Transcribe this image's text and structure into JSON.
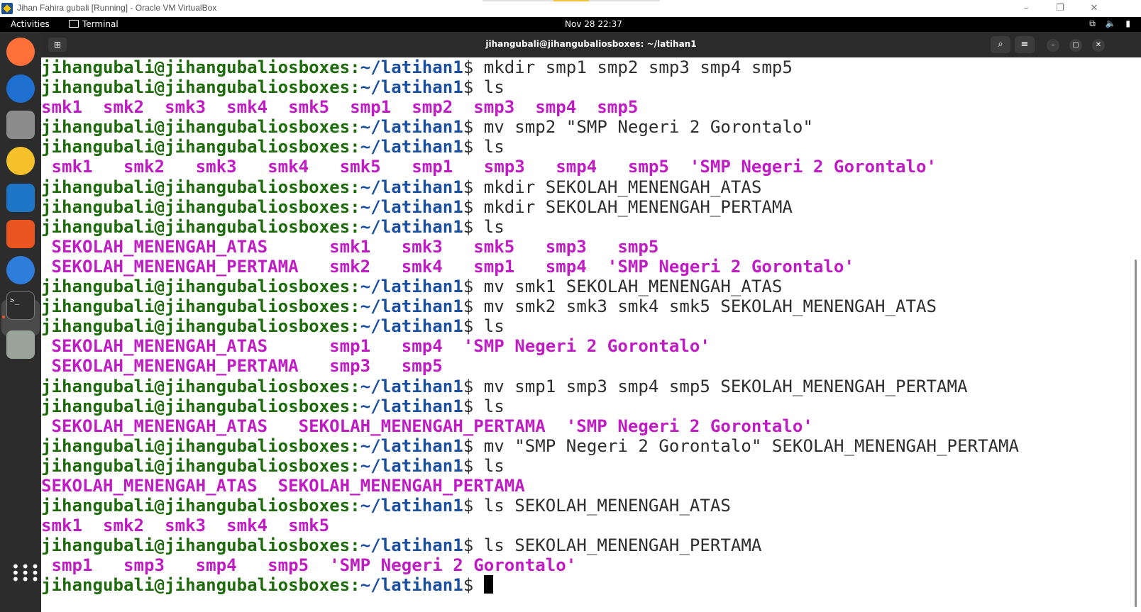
{
  "host_window": {
    "title": "Jihan Fahira gubali [Running] - Oracle VM VirtualBox",
    "controls": [
      "–",
      "❐",
      "✕"
    ]
  },
  "topbar": {
    "activities": "Activities",
    "app_name": "Terminal",
    "datetime": "Nov 28  22:37",
    "tray_icons": [
      "network-icon",
      "volume-icon",
      "battery-icon"
    ],
    "tray_glyphs": "⧉ 🔈 ▮"
  },
  "dock": {
    "apps": [
      {
        "name": "firefox-icon",
        "color": "#ff7139"
      },
      {
        "name": "thunderbird-icon",
        "color": "#1f6fd1"
      },
      {
        "name": "files-icon",
        "color": "#8c8c8c"
      },
      {
        "name": "rhythmbox-icon",
        "color": "#f6c12b"
      },
      {
        "name": "libreoffice-writer-icon",
        "color": "#1e75c8"
      },
      {
        "name": "app-center-icon",
        "color": "#e95420"
      },
      {
        "name": "help-icon",
        "color": "#2f7ddb"
      },
      {
        "name": "terminal-icon",
        "color": "#2d2d2d"
      },
      {
        "name": "trash-icon",
        "color": "#9aa39a"
      }
    ],
    "show_apps_glyph": "⋮⋮⋮"
  },
  "terminal": {
    "title": "jihangubali@jihangubaliosboxes: ~/latihan1",
    "buttons": {
      "new_tab": "⊞",
      "search": "⌕",
      "menu": "≡",
      "minimize": "–",
      "maximize": "▢",
      "close": "✕"
    },
    "prompt": {
      "user": "jihangubali@jihangubaliosboxes",
      "colon": ":",
      "path": "~/latihan1",
      "dollar": "$ "
    },
    "lines": [
      {
        "type": "cmd",
        "text": "mkdir smp1 smp2 smp3 smp4 smp5"
      },
      {
        "type": "cmd",
        "text": "ls"
      },
      {
        "type": "out",
        "text": "smk1  smk2  smk3  smk4  smk5  smp1  smp2  smp3  smp4  smp5"
      },
      {
        "type": "cmd",
        "text": "mv smp2 \"SMP Negeri 2 Gorontalo\""
      },
      {
        "type": "cmd",
        "text": "ls"
      },
      {
        "type": "out",
        "text": " smk1   smk2   smk3   smk4   smk5   smp1   smp3   smp4   smp5  'SMP Negeri 2 Gorontalo'"
      },
      {
        "type": "cmd",
        "text": "mkdir SEKOLAH_MENENGAH_ATAS"
      },
      {
        "type": "cmd",
        "text": "mkdir SEKOLAH_MENENGAH_PERTAMA"
      },
      {
        "type": "cmd",
        "text": "ls"
      },
      {
        "type": "out",
        "text": " SEKOLAH_MENENGAH_ATAS      smk1   smk3   smk5   smp3   smp5"
      },
      {
        "type": "out",
        "text": " SEKOLAH_MENENGAH_PERTAMA   smk2   smk4   smp1   smp4  'SMP Negeri 2 Gorontalo'"
      },
      {
        "type": "cmd",
        "text": "mv smk1 SEKOLAH_MENENGAH_ATAS"
      },
      {
        "type": "cmd",
        "text": "mv smk2 smk3 smk4 smk5 SEKOLAH_MENENGAH_ATAS"
      },
      {
        "type": "cmd",
        "text": "ls"
      },
      {
        "type": "out",
        "text": " SEKOLAH_MENENGAH_ATAS      smp1   smp4  'SMP Negeri 2 Gorontalo'"
      },
      {
        "type": "out",
        "text": " SEKOLAH_MENENGAH_PERTAMA   smp3   smp5"
      },
      {
        "type": "cmd",
        "text": "mv smp1 smp3 smp4 smp5 SEKOLAH_MENENGAH_PERTAMA"
      },
      {
        "type": "cmd",
        "text": "ls"
      },
      {
        "type": "out",
        "text": " SEKOLAH_MENENGAH_ATAS   SEKOLAH_MENENGAH_PERTAMA  'SMP Negeri 2 Gorontalo'"
      },
      {
        "type": "cmd",
        "text": "mv \"SMP Negeri 2 Gorontalo\" SEKOLAH_MENENGAH_PERTAMA"
      },
      {
        "type": "cmd",
        "text": "ls"
      },
      {
        "type": "out",
        "text": "SEKOLAH_MENENGAH_ATAS  SEKOLAH_MENENGAH_PERTAMA"
      },
      {
        "type": "cmd",
        "text": "ls SEKOLAH_MENENGAH_ATAS"
      },
      {
        "type": "out",
        "text": "smk1  smk2  smk3  smk4  smk5"
      },
      {
        "type": "cmd",
        "text": "ls SEKOLAH_MENENGAH_PERTAMA"
      },
      {
        "type": "out",
        "text": " smp1   smp3   smp4   smp5  'SMP Negeri 2 Gorontalo'"
      },
      {
        "type": "prompt",
        "text": ""
      }
    ]
  }
}
